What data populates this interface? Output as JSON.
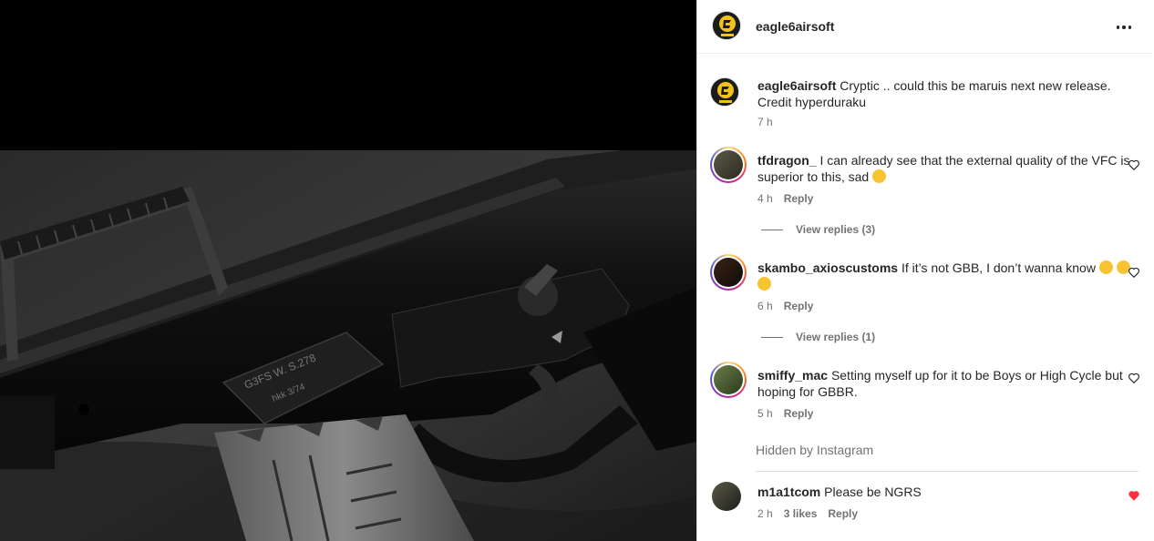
{
  "post": {
    "author": "eagle6airsoft"
  },
  "caption": {
    "username": "eagle6airsoft",
    "text": "Cryptic .. could this be maruis next new release. Credit hyperduraku",
    "time": "7 h"
  },
  "comments": [
    {
      "username": "tfdragon_",
      "text": "I can already see that the external quality of the VFC is superior to this, sad",
      "time": "4 h",
      "reply": "Reply",
      "view_replies": "View replies (3)"
    },
    {
      "username": "skambo_axioscustoms",
      "text": "If it’s not GBB, I don’t wanna know",
      "time": "6 h",
      "reply": "Reply",
      "view_replies": "View replies (1)"
    },
    {
      "username": "smiffy_mac",
      "text": "Setting myself up for it to be Boys or High Cycle but hoping for GBBR.",
      "time": "5 h",
      "reply": "Reply"
    },
    {
      "username": "m1a1tcom",
      "text": "Please be NGRS",
      "time": "2 h",
      "likes": "3 likes",
      "reply": "Reply",
      "liked": true
    }
  ],
  "hidden_label": "Hidden by Instagram",
  "icons": {
    "more": "more-horizontal-icon",
    "heart": "heart-icon",
    "heart_filled": "heart-filled-icon"
  },
  "colors": {
    "liked_heart": "#ff3040",
    "secondary_text": "#737373"
  }
}
